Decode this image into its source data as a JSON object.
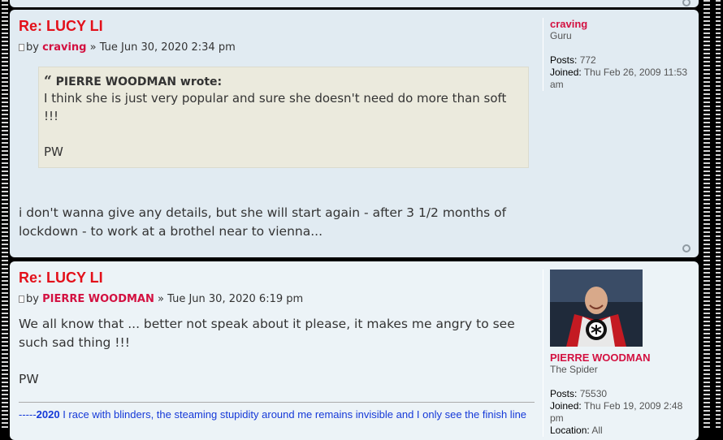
{
  "post1": {
    "title": "Re: LUCY LI",
    "by": "by",
    "author": "craving",
    "date": "» Tue Jun 30, 2020 2:34 pm",
    "quote": {
      "cite": "PIERRE WOODMAN wrote:",
      "line1": "I think she is just very popular and sure she doesn't need do more than soft !!!",
      "line2": "PW"
    },
    "content": "i don't wanna give any details, but she will start again - after 3 1/2 months of lockdown - to work at a brothel near to vienna...",
    "profile": {
      "username": "craving",
      "rank": "Guru",
      "posts_label": "Posts:",
      "posts": "772",
      "joined_label": "Joined:",
      "joined": "Thu Feb 26, 2009 11:53 am"
    }
  },
  "post2": {
    "title": "Re: LUCY LI",
    "by": "by",
    "author": "PIERRE WOODMAN",
    "date": "» Tue Jun 30, 2020 6:19 pm",
    "content_line1": "We all know that ... better not speak about it please, it makes me angry to see such sad thing !!!",
    "content_line2": "PW",
    "signature": {
      "prefix": "-----",
      "year": "2020",
      "text": " I race with blinders, the steaming stupidity around me remains invisible and I only see the finish line"
    },
    "profile": {
      "username": "PIERRE WOODMAN",
      "rank": "The Spider",
      "posts_label": "Posts:",
      "posts": "75530",
      "joined_label": "Joined:",
      "joined": "Thu Feb 19, 2009 2:48 pm",
      "location_label": "Location:",
      "location": "All"
    }
  },
  "colors": {
    "post_title": "#e3101a",
    "author": "#d31141",
    "signature": "#1539d8",
    "post_bg_a": "#e1ebf2",
    "post_bg_b": "#ecf3f7",
    "quote_bg": "#ebeadd"
  },
  "icons": {
    "post_icon": "document-icon",
    "gear": "gear-icon"
  }
}
